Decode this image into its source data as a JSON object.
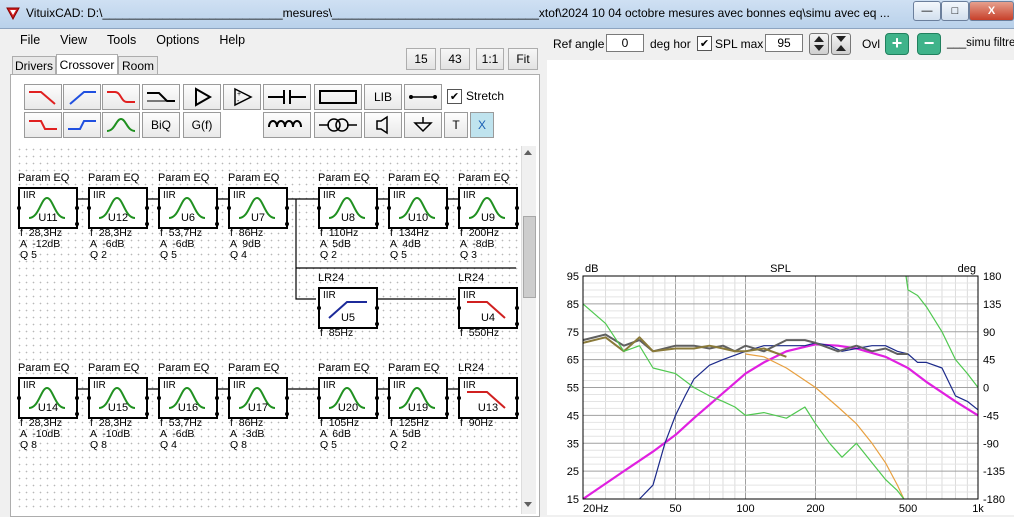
{
  "window": {
    "title": "VituixCAD: D:\\___________________________mesures\\_______________________________xtof\\2024 10 04 octobre mesures avec bonnes eq\\simu avec eq ...",
    "min_label": "—",
    "max_label": "□",
    "close_label": "X"
  },
  "menu": [
    "File",
    "View",
    "Tools",
    "Options",
    "Help"
  ],
  "top_buttons": {
    "val1": "15",
    "val2": "43",
    "ratio": "1:1",
    "fit": "Fit"
  },
  "tabs": [
    "Drivers",
    "Crossover",
    "Room"
  ],
  "toolbar": {
    "lib": "LIB",
    "biq": "BiQ",
    "gf": "G(f)",
    "stretch_label": "Stretch",
    "t": "T",
    "x": "X"
  },
  "blocks_row1": [
    {
      "type": "Param EQ",
      "iir": "IIR",
      "id": "U11",
      "f": "f  28,3Hz",
      "a": "A  -12dB",
      "q": "Q 5"
    },
    {
      "type": "Param EQ",
      "iir": "IIR",
      "id": "U12",
      "f": "f  28,3Hz",
      "a": "A  -6dB",
      "q": "Q 2"
    },
    {
      "type": "Param EQ",
      "iir": "IIR",
      "id": "U6",
      "f": "f  53,7Hz",
      "a": "A  -6dB",
      "q": "Q 5"
    },
    {
      "type": "Param EQ",
      "iir": "IIR",
      "id": "U7",
      "f": "f  86Hz",
      "a": "A  9dB",
      "q": "Q 4"
    },
    {
      "type": "Param EQ",
      "iir": "IIR",
      "id": "U8",
      "f": "f  110Hz",
      "a": "A  5dB",
      "q": "Q 2"
    },
    {
      "type": "Param EQ",
      "iir": "IIR",
      "id": "U10",
      "f": "f  134Hz",
      "a": "A  4dB",
      "q": "Q 5"
    },
    {
      "type": "Param EQ",
      "iir": "IIR",
      "id": "U9",
      "f": "f  200Hz",
      "a": "A  -8dB",
      "q": "Q 3"
    }
  ],
  "blocks_row2": [
    {
      "type": "LR24",
      "iir": "IIR",
      "id": "U5",
      "f": "f  85Hz"
    },
    {
      "type": "LR24",
      "iir": "IIR",
      "id": "U4",
      "f": "f  550Hz"
    }
  ],
  "blocks_row3": [
    {
      "type": "Param EQ",
      "iir": "IIR",
      "id": "U14",
      "f": "f  28,3Hz",
      "a": "A  -10dB",
      "q": "Q 8"
    },
    {
      "type": "Param EQ",
      "iir": "IIR",
      "id": "U15",
      "f": "f  28,3Hz",
      "a": "A  -10dB",
      "q": "Q 8"
    },
    {
      "type": "Param EQ",
      "iir": "IIR",
      "id": "U16",
      "f": "f  53,7Hz",
      "a": "A  -6dB",
      "q": "Q 4"
    },
    {
      "type": "Param EQ",
      "iir": "IIR",
      "id": "U17",
      "f": "f  86Hz",
      "a": "A  -3dB",
      "q": "Q 8"
    },
    {
      "type": "Param EQ",
      "iir": "IIR",
      "id": "U20",
      "f": "f  105Hz",
      "a": "A  6dB",
      "q": "Q 5"
    },
    {
      "type": "Param EQ",
      "iir": "IIR",
      "id": "U19",
      "f": "f  125Hz",
      "a": "A  5dB",
      "q": "Q 2"
    },
    {
      "type": "LR24",
      "iir": "IIR",
      "id": "U13",
      "f": "f  90Hz"
    }
  ],
  "right_toolbar": {
    "ref_angle_label": "Ref angle",
    "ref_angle_value": "0",
    "deg_hor_label": "deg hor",
    "spl_max_label": "SPL max",
    "spl_max_value": "95",
    "ovl_label": "Ovl",
    "name_value": "___simu  filtre"
  },
  "chart_data": {
    "type": "line",
    "title": "SPL",
    "ylabel": "dB",
    "y2label": "deg",
    "ylim": [
      15,
      95
    ],
    "y2lim": [
      -180,
      180
    ],
    "xscale": "log",
    "xlim": [
      20,
      1000
    ],
    "yticks": [
      "95",
      "85",
      "75",
      "65",
      "55",
      "45",
      "35",
      "25",
      "15"
    ],
    "y2ticks": [
      "180",
      "135",
      "90",
      "45",
      "0",
      "-45",
      "-90",
      "-135",
      "-180"
    ],
    "xticks": [
      {
        "v": 20,
        "label": "20Hz"
      },
      {
        "v": 50,
        "label": "50"
      },
      {
        "v": 100,
        "label": "100"
      },
      {
        "v": 200,
        "label": "200"
      },
      {
        "v": 500,
        "label": "500"
      },
      {
        "v": 1000,
        "label": "1k"
      }
    ],
    "colors": {
      "magenta": "#e020e0",
      "navy": "#1c2a8a",
      "olive": "#8a7a3a",
      "orange": "#e8a040",
      "green": "#50c850",
      "gray": "#606060"
    },
    "series": [
      {
        "color": "magenta",
        "x": [
          20,
          30,
          40,
          50,
          60,
          80,
          100,
          120,
          150,
          200,
          250,
          300,
          400,
          500,
          600,
          800,
          1000
        ],
        "y": [
          15,
          25,
          32,
          38,
          44,
          53,
          60,
          64,
          68,
          70.5,
          70,
          69,
          66,
          62,
          57,
          50,
          45
        ]
      },
      {
        "color": "navy",
        "x": [
          35,
          40,
          45,
          50,
          55,
          60,
          70,
          80,
          100,
          120,
          150,
          180,
          200,
          230,
          260,
          300,
          350,
          400,
          450,
          500,
          550,
          600,
          700,
          800,
          900,
          1000
        ],
        "y": [
          15,
          20,
          35,
          45,
          52,
          58,
          63,
          65,
          68,
          70,
          70,
          70,
          71,
          70,
          68,
          69,
          70,
          70,
          68,
          67,
          64,
          64,
          62,
          52,
          50,
          47
        ]
      },
      {
        "color": "gray",
        "x": [
          20,
          25,
          30,
          35,
          40,
          50,
          60,
          70,
          80,
          90,
          100,
          120,
          150,
          180,
          200,
          250,
          300,
          350,
          400,
          450,
          500
        ],
        "y": [
          72,
          74,
          70,
          72,
          68,
          70,
          70,
          69,
          70,
          68,
          70,
          68,
          72,
          72,
          71,
          68,
          70,
          68,
          69,
          67,
          67
        ]
      },
      {
        "color": "olive",
        "x": [
          20,
          25,
          30,
          35,
          40,
          50,
          60,
          70,
          80,
          90,
          100,
          120,
          150
        ],
        "y": [
          71,
          73,
          68,
          73,
          68,
          69,
          69,
          70,
          69,
          68,
          68,
          69,
          66
        ]
      },
      {
        "color": "orange",
        "x": [
          100,
          120,
          150,
          200,
          250,
          300,
          350,
          400,
          450,
          480
        ],
        "y": [
          67,
          66,
          62,
          55,
          48,
          42,
          35,
          28,
          20,
          15
        ]
      },
      {
        "color": "green",
        "x": [
          20,
          25,
          30,
          35,
          40,
          50,
          60,
          70,
          80,
          90,
          100,
          120,
          150,
          180,
          200,
          230,
          260,
          300,
          350,
          400,
          450,
          480
        ],
        "y": [
          85,
          78,
          68,
          70,
          62,
          60,
          55,
          52,
          50,
          48,
          45,
          46,
          44,
          48,
          42,
          35,
          30,
          35,
          28,
          22,
          18,
          15
        ]
      },
      {
        "color": "green",
        "x": [
          490,
          500,
          550,
          600,
          700,
          800,
          900,
          1000
        ],
        "y": [
          95,
          90,
          88,
          84,
          75,
          65,
          60,
          55
        ]
      }
    ]
  }
}
